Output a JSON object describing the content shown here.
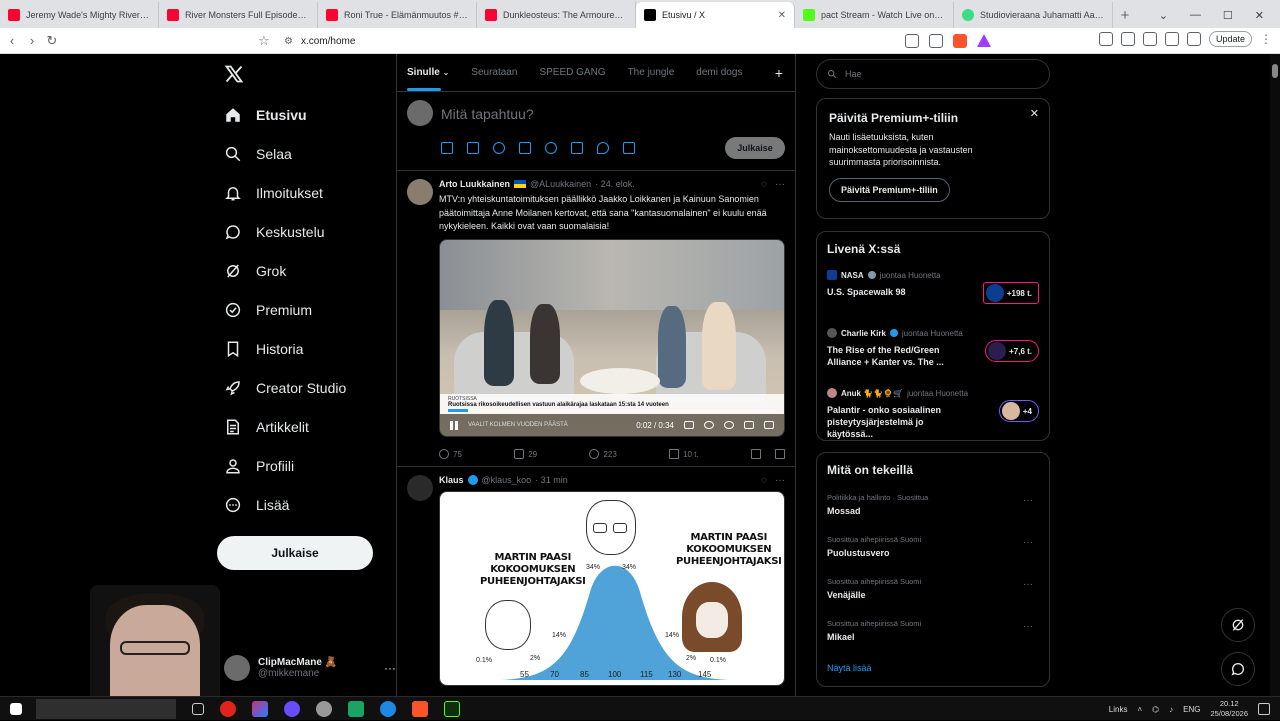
{
  "browser": {
    "tabs": [
      {
        "label": "Jeremy Wade's Mighty Rivers - Full I",
        "favicon_color": "#ff0033"
      },
      {
        "label": "River Monsters Full Episode - Size M",
        "favicon_color": "#ff0033"
      },
      {
        "label": "Roni True - Elämänmuutos #lanusel",
        "favicon_color": "#ff0033"
      },
      {
        "label": "Dunkleosteus: The Armoured Prehis",
        "favicon_color": "#ff0033"
      },
      {
        "label": "Etusivu / X",
        "favicon_color": "#000000"
      },
      {
        "label": "pact Stream - Watch Live on Kic",
        "favicon_color": "#53fc18"
      },
      {
        "label": "Studiovieraana Juhamatti Aaltonen",
        "favicon_color": "#3ddc84"
      }
    ],
    "url": "x.com/home",
    "update_label": "Update"
  },
  "nav": {
    "items": [
      {
        "label": "Etusivu"
      },
      {
        "label": "Selaa"
      },
      {
        "label": "Ilmoitukset"
      },
      {
        "label": "Keskustelu"
      },
      {
        "label": "Grok"
      },
      {
        "label": "Premium"
      },
      {
        "label": "Historia"
      },
      {
        "label": "Creator Studio"
      },
      {
        "label": "Artikkelit"
      },
      {
        "label": "Profiili"
      },
      {
        "label": "Lisää"
      }
    ],
    "post_button": "Julkaise",
    "profile": {
      "name": "ClipMacMane 🧸",
      "handle": "@mikkemane"
    }
  },
  "main": {
    "tabs": [
      "Sinulle",
      "Seurataan",
      "SPEED GANG",
      "The jungle",
      "demi dogs"
    ],
    "compose": {
      "placeholder": "Mitä tapahtuu?",
      "button": "Julkaise"
    },
    "tweets": [
      {
        "name": "Arto Luukkainen",
        "handle": "@ALuukkainen",
        "time": "· 24. elok.",
        "text": "MTV:n yhteiskuntatoimituksen päällikkö Jaakko Loikkanen ja Kainuun Sanomien päätoimittaja Anne Moilanen kertovat, että sana \"kantasuomalainen\" ei kuulu enää nykykieleen. Kaikki ovat vaan suomalaisia!",
        "video": {
          "caption_small": "RUOTSISSA",
          "caption": "Ruotsissa rikosoikeudellisen vastuun alaikärajaa laskataan 15:sta 14 vuoteen",
          "ticker": "VAALIT KOLMEN VUODEN PÄÄSTÄ",
          "time": "0:02 / 0:34",
          "progress": 0.06
        },
        "replies": "75",
        "reposts": "29",
        "likes": "223",
        "views": "10 t."
      },
      {
        "name": "Klaus",
        "handle": "@klaus_koo",
        "time": "· 31 min",
        "meme": {
          "left_title": "MARTIN PAASI\nKOKOOMUKSEN\nPUHEENJOHTAJAKSI",
          "right_title": "MARTIN PAASI\nKOKOOMUKSEN\nPUHEENJOHTAJAKSI",
          "pct_left_outer": "0.1%",
          "pct_left_mid": "2%",
          "pct_left_inner": "14%",
          "pct_top_left": "34%",
          "pct_top_right": "34%",
          "pct_right_inner": "14%",
          "pct_right_mid": "2%",
          "pct_right_outer": "0.1%",
          "axis": [
            "55",
            "70",
            "85",
            "100",
            "115",
            "130",
            "145"
          ]
        }
      }
    ]
  },
  "right": {
    "search_placeholder": "Hae",
    "premium": {
      "title": "Päivitä Premium+-tiliin",
      "text": "Nauti lisäetuuksista, kuten mainoksettomuudesta ja vastausten suurimmasta priorisoinnista.",
      "button": "Päivitä Premium+-tiliin"
    },
    "live": {
      "title": "Livenä X:ssä",
      "items": [
        {
          "who": "NASA",
          "suffix": "juontaa Huonetta",
          "title": "U.S. Spacewalk 98",
          "badge": "+198 t."
        },
        {
          "who": "Charlie Kirk",
          "suffix": "juontaa Huonetta",
          "title": "The Rise of the Red/Green Alliance + Kanter vs. The ...",
          "badge": "+7,6 t."
        },
        {
          "who": "Anuk 🐈🐈🌻🛒",
          "suffix": "juontaa Huonetta",
          "title": "Palantir - onko sosiaalinen pisteytysjärjestelmä jo käytössä...",
          "badge": "+4"
        }
      ]
    },
    "trends": {
      "title": "Mitä on tekeillä",
      "items": [
        {
          "meta": "Politiikka ja hallinto · Suosittua",
          "name": "Mossad"
        },
        {
          "meta": "Suosittua aihepiirissä Suomi",
          "name": "Puolustusvero"
        },
        {
          "meta": "Suosittua aihepiirissä Suomi",
          "name": "Venäjälle"
        },
        {
          "meta": "Suosittua aihepiirissä Suomi",
          "name": "Mikael"
        }
      ],
      "show_more": "Näytä lisää"
    }
  },
  "taskbar": {
    "links": "Links",
    "lang": "ENG",
    "time": "20.12",
    "date": "25/08/2026"
  },
  "colors": {
    "accent": "#1d9bf0",
    "live": "#f91880",
    "background": "#000000"
  }
}
